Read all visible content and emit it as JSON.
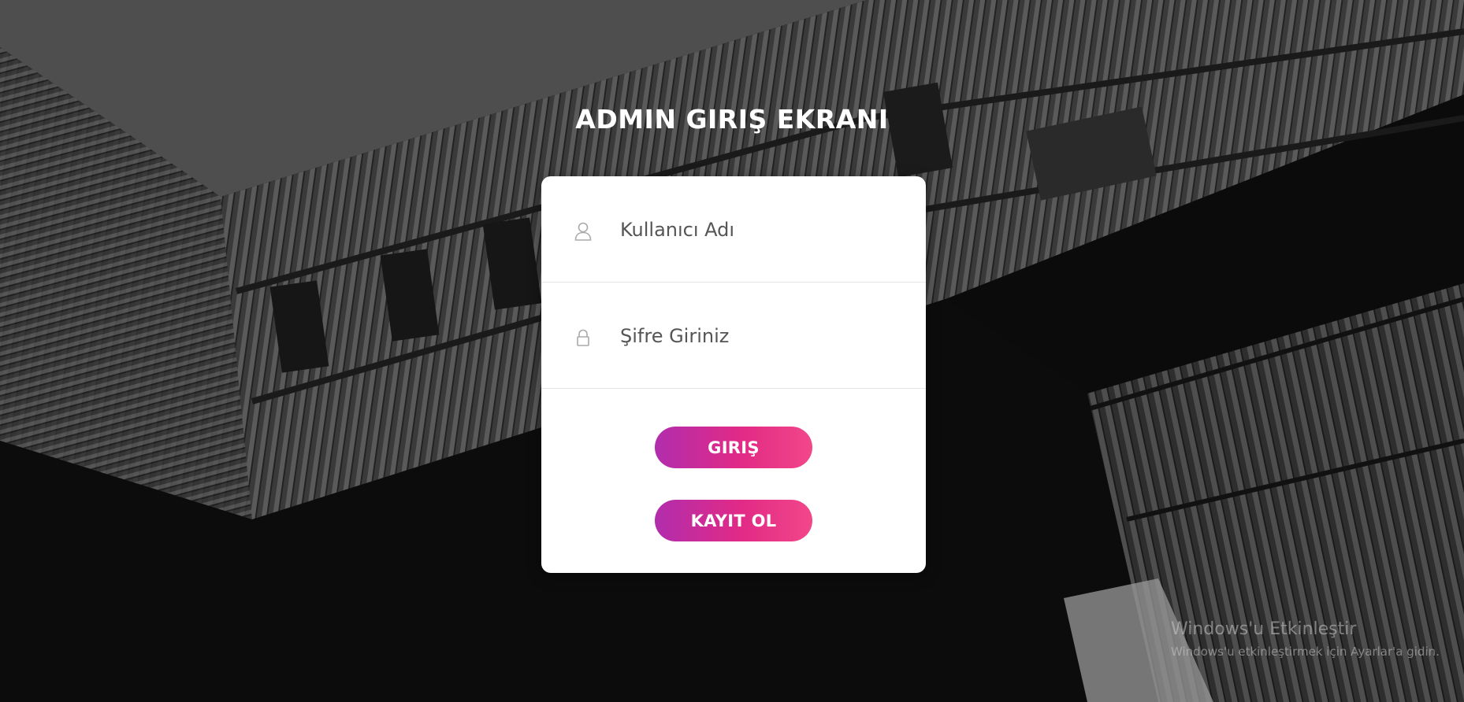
{
  "page": {
    "title": "ADMIN GIRIŞ EKRANI"
  },
  "form": {
    "username_placeholder": "Kullanıcı Adı",
    "password_placeholder": "Şifre Giriniz",
    "login_label": "GIRIŞ",
    "register_label": "KAYIT OL"
  },
  "icons": {
    "username": "user-icon",
    "password": "lock-icon"
  },
  "watermark": {
    "title": "Windows'u Etkinleştir",
    "subtitle": "Windows'u etkinleştirmek için Ayarlar'a gidin."
  },
  "colors": {
    "button_gradient_start": "#b12dad",
    "button_gradient_end": "#f2478a",
    "card_background": "#ffffff",
    "title_color": "#ffffff"
  }
}
